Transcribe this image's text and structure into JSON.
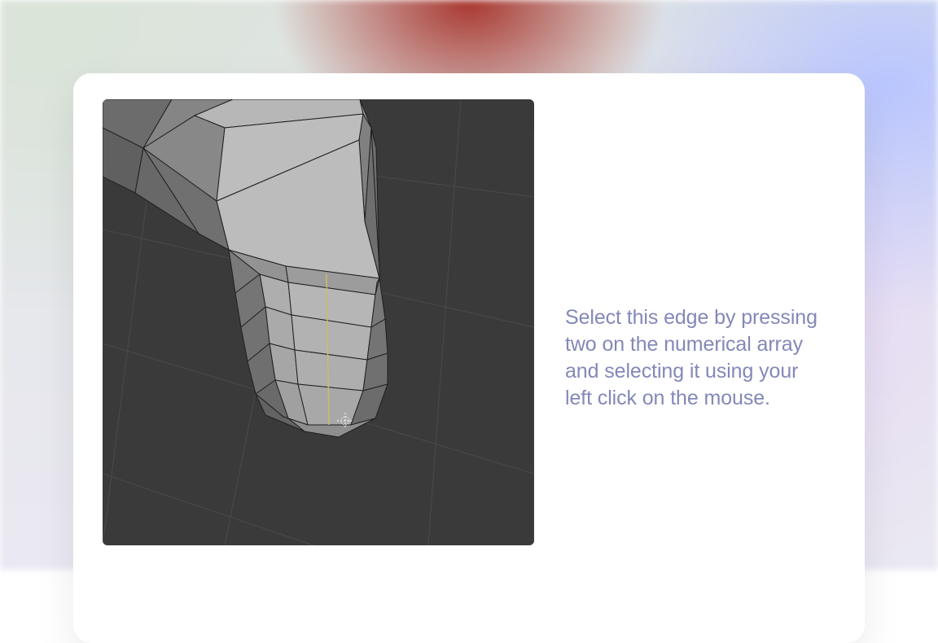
{
  "instruction": {
    "text": "Select this edge by pressing two on the numerical array and selecting it using your left click on the mouse."
  },
  "colors": {
    "card_bg": "#ffffff",
    "viewport_bg": "#3a3a3a",
    "text": "#8388b8",
    "edge_highlight": "#d8b867"
  }
}
